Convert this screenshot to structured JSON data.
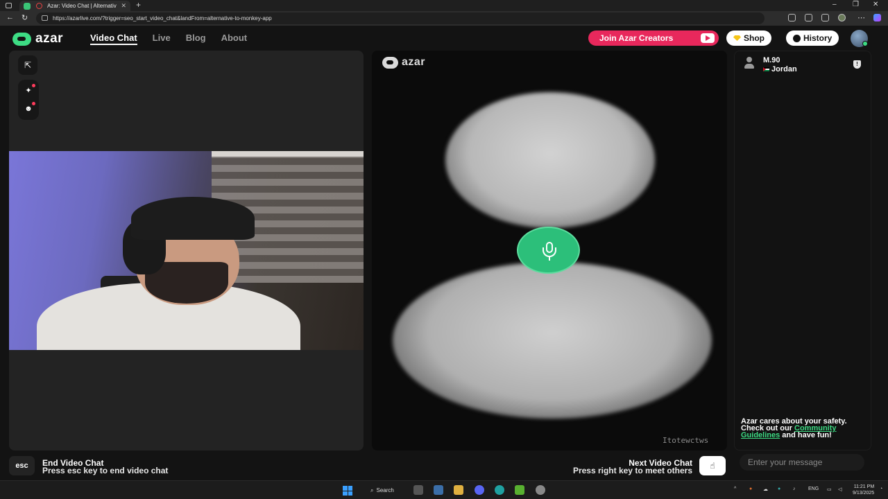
{
  "browser": {
    "tab_title": "Azar: Video Chat | Alternativ",
    "url": "https://azarlive.com/?trigger=seo_start_video_chat&landFrom=alternative-to-monkey-app"
  },
  "brand": {
    "logo_text": "azar",
    "accent_color": "#3ddc84",
    "creators_color": "#e8285c"
  },
  "nav": {
    "items": [
      {
        "label": "Video Chat",
        "active": true
      },
      {
        "label": "Live",
        "active": false
      },
      {
        "label": "Blog",
        "active": false
      },
      {
        "label": "About",
        "active": false
      }
    ]
  },
  "header": {
    "creators_label": "Join Azar Creators",
    "shop_label": "Shop",
    "history_label": "History"
  },
  "partner": {
    "name": "M.90",
    "country": "Jordan",
    "watermark": "Itotewctws"
  },
  "chat": {
    "safety_prefix": "Azar cares about your safety. Check out our ",
    "safety_link": "Community Guidelines",
    "safety_suffix": " and have fun!",
    "input_placeholder": "Enter your message"
  },
  "bottom": {
    "esc_key": "esc",
    "end_title": "End Video Chat",
    "end_sub": "Press esc key to end video chat",
    "next_title": "Next Video Chat",
    "next_sub": "Press right key to meet others",
    "next_key_icon": "hand-pointer-icon"
  },
  "taskbar": {
    "search_label": "Search",
    "lang": "ENG",
    "time": "11:21 PM",
    "date": "9/13/2025"
  }
}
